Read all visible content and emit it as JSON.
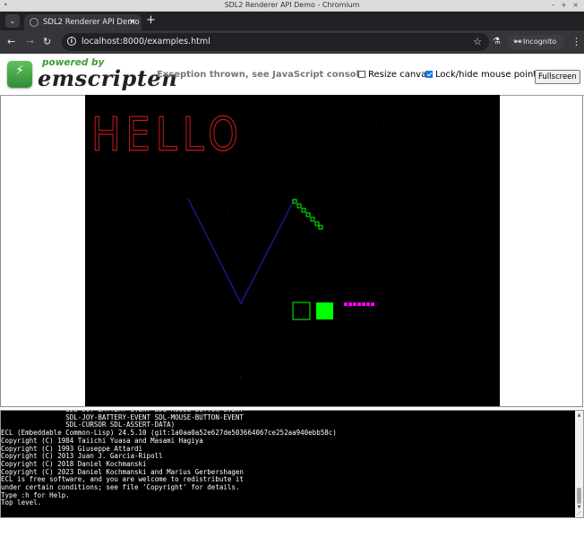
{
  "window": {
    "title": "SDL2 Renderer API Demo - Chromium",
    "controls": "– + ×"
  },
  "tabs": [
    {
      "label": "SDL2 Renderer API Demo",
      "close": "×"
    }
  ],
  "toolbar": {
    "url": "localhost:8000/examples.html",
    "incognito_label": "Incognito"
  },
  "header": {
    "powered_by": "powered by",
    "logo_text": "emscripten",
    "status": "Exception thrown, see JavaScript console",
    "resize_canvas_label": "Resize canvas",
    "resize_canvas_checked": false,
    "lock_pointer_label": "Lock/hide mouse pointer",
    "lock_pointer_checked": true,
    "fullscreen_label": "Fullscreen"
  },
  "canvas": {
    "text": "HELLO",
    "text_color": "#c41a1a",
    "line_color": "#1d1db4",
    "square_color": "#00ff00",
    "dot_color": "#ff00ff"
  },
  "console": {
    "lines": [
      "                SDL-JOY-BATTERY-EVENT SDL-MOUSE-BUTTON-EVENT",
      "                SDL-JOY-BATTERY-EVENT SDL-MOUSE-BUTTON-EVENT",
      "                SDL-CURSOR SDL-ASSERT-DATA)",
      "ECL (Embeddable Common-Lisp) 24.5.10 (git:1a0aa0a52e627de503664067ce252aa940ebb58c)",
      "Copyright (C) 1984 Taiichi Yuasa and Masami Hagiya",
      "Copyright (C) 1993 Giuseppe Attardi",
      "Copyright (C) 2013 Juan J. Garcia-Ripoll",
      "Copyright (C) 2018 Daniel Kochmanski",
      "Copyright (C) 2023 Daniel Kochmanski and Marius Gerbershagen",
      "ECL is free software, and you are welcome to redistribute it",
      "under certain conditions; see file 'Copyright' for details.",
      "Type :h for Help.",
      "Top level."
    ]
  }
}
